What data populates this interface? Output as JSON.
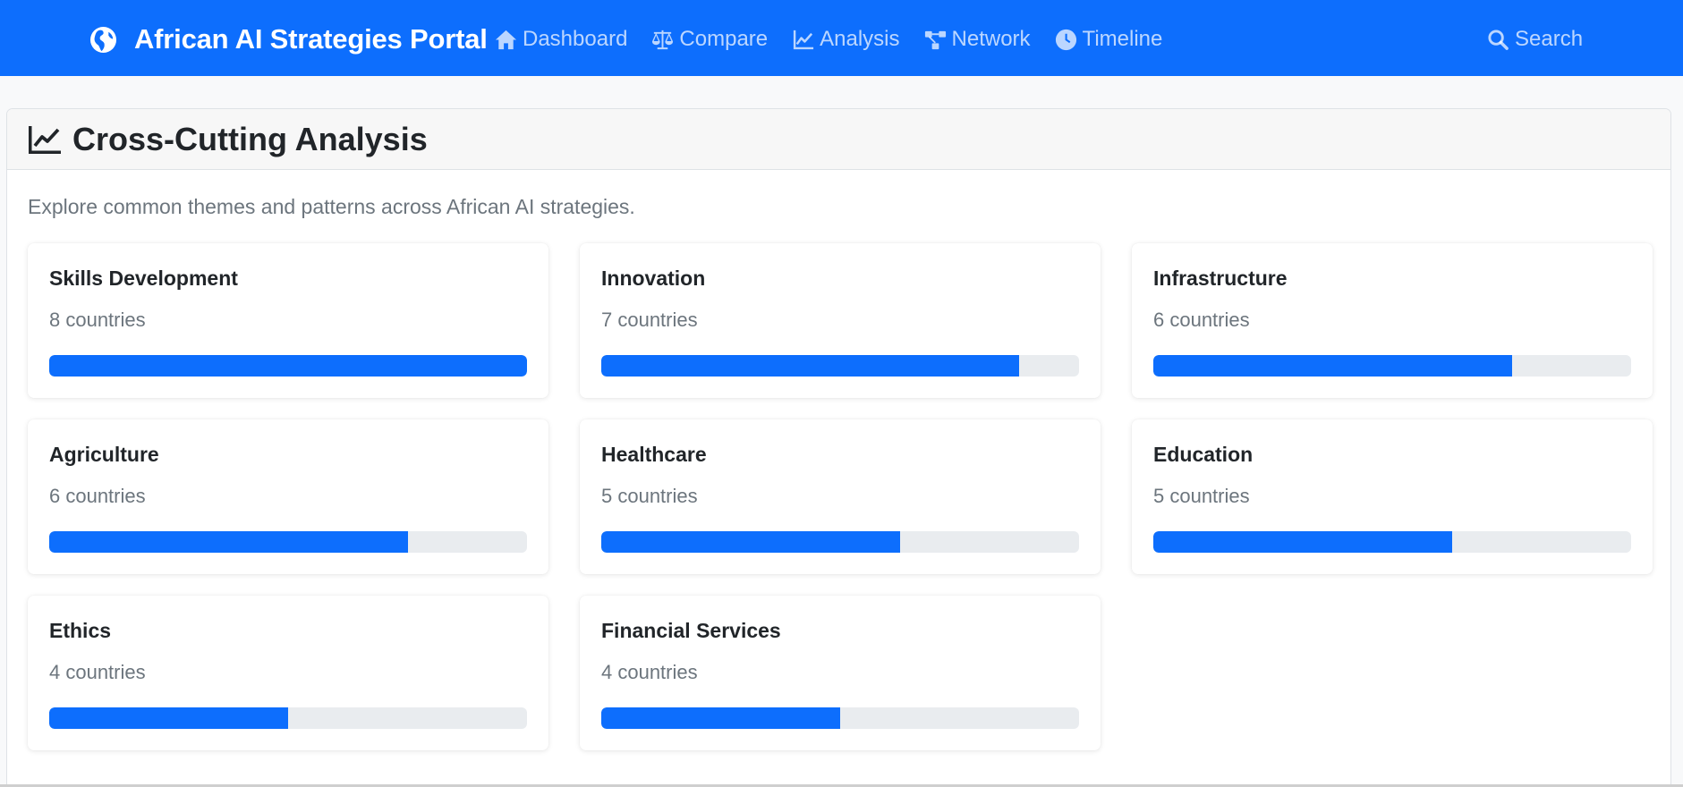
{
  "app": {
    "title": "African AI Strategies Portal",
    "brand_icon": "globe-africa-icon",
    "accent_color": "#0d6efd"
  },
  "nav": {
    "items": [
      {
        "label": "Dashboard",
        "icon": "home-icon"
      },
      {
        "label": "Compare",
        "icon": "balance-scale-icon"
      },
      {
        "label": "Analysis",
        "icon": "line-chart-icon"
      },
      {
        "label": "Network",
        "icon": "network-icon"
      },
      {
        "label": "Timeline",
        "icon": "clock-icon"
      }
    ],
    "search_label": "Search"
  },
  "page": {
    "title": "Cross-Cutting Analysis",
    "title_icon": "line-chart-icon",
    "description": "Explore common themes and patterns across African AI strategies."
  },
  "themes": [
    {
      "name": "Skills Development",
      "count_label": "8 countries",
      "progress": 1.0
    },
    {
      "name": "Innovation",
      "count_label": "7 countries",
      "progress": 0.875
    },
    {
      "name": "Infrastructure",
      "count_label": "6 countries",
      "progress": 0.75
    },
    {
      "name": "Agriculture",
      "count_label": "6 countries",
      "progress": 0.75
    },
    {
      "name": "Healthcare",
      "count_label": "5 countries",
      "progress": 0.625
    },
    {
      "name": "Education",
      "count_label": "5 countries",
      "progress": 0.625
    },
    {
      "name": "Ethics",
      "count_label": "4 countries",
      "progress": 0.5
    },
    {
      "name": "Financial Services",
      "count_label": "4 countries",
      "progress": 0.5
    }
  ]
}
